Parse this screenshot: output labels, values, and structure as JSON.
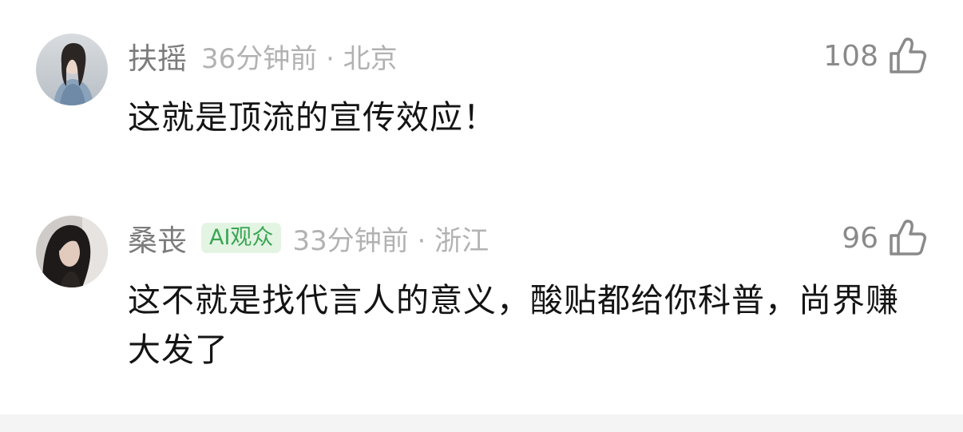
{
  "comments": [
    {
      "username": "扶摇",
      "badge": "",
      "time_location": "36分钟前 · 北京",
      "likes": "108",
      "content": "这就是顶流的宣传效应！"
    },
    {
      "username": "桑丧",
      "badge": "AI观众",
      "time_location": "33分钟前 · 浙江",
      "likes": "96",
      "content": "这不就是找代言人的意义，酸贴都给你科普，尚界赚大发了"
    }
  ],
  "colors": {
    "badge_text": "#3aa653",
    "badge_bg": "#e3f4e3",
    "meta_gray": "#b2b2b2",
    "username_gray": "#7c7c7c"
  },
  "icons": {
    "like": "thumbs-up-icon"
  }
}
